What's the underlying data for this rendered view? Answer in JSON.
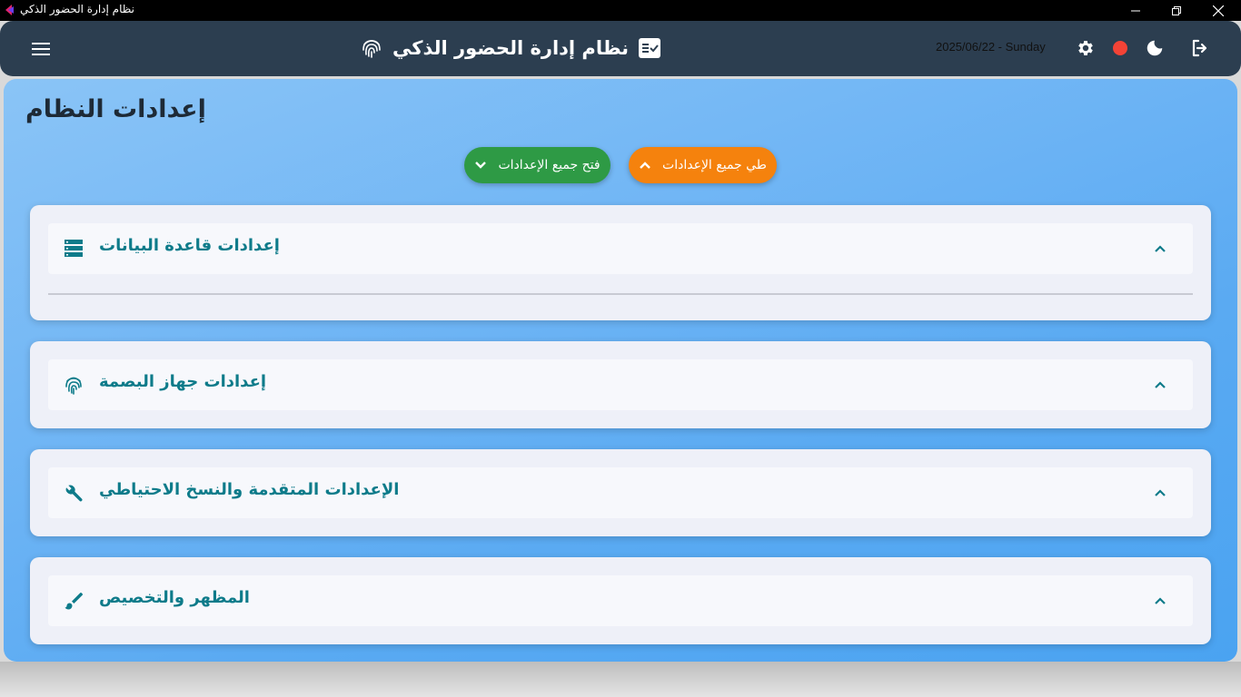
{
  "window": {
    "title": "نظام إدارة الحضور الذكي",
    "minimize_icon": "minimize-icon",
    "maximize_icon": "restore-icon",
    "close_icon": "close-icon"
  },
  "header": {
    "brand_title": "نظام إدارة الحضور الذكي",
    "date_text": "2025/06/22 - Sunday",
    "status_color": "#f44336",
    "background": "#2c3e50"
  },
  "page": {
    "title": "إعدادات النظام",
    "collapse_all_label": "طي جميع الإعدادات",
    "expand_all_label": "فتح جميع الإعدادات",
    "collapse_color": "#f5820d",
    "expand_color": "#2e9a45"
  },
  "sections": [
    {
      "label": "إعدادات قاعدة البيانات",
      "icon": "database-icon"
    },
    {
      "label": "إعدادات جهاز البصمة",
      "icon": "fingerprint-icon"
    },
    {
      "label": "الإعدادات المتقدمة والنسخ الاحتياطي",
      "icon": "wrench-icon"
    },
    {
      "label": "المظهر والتخصيص",
      "icon": "brush-icon"
    }
  ],
  "accent_text_color": "#0e7b8a"
}
